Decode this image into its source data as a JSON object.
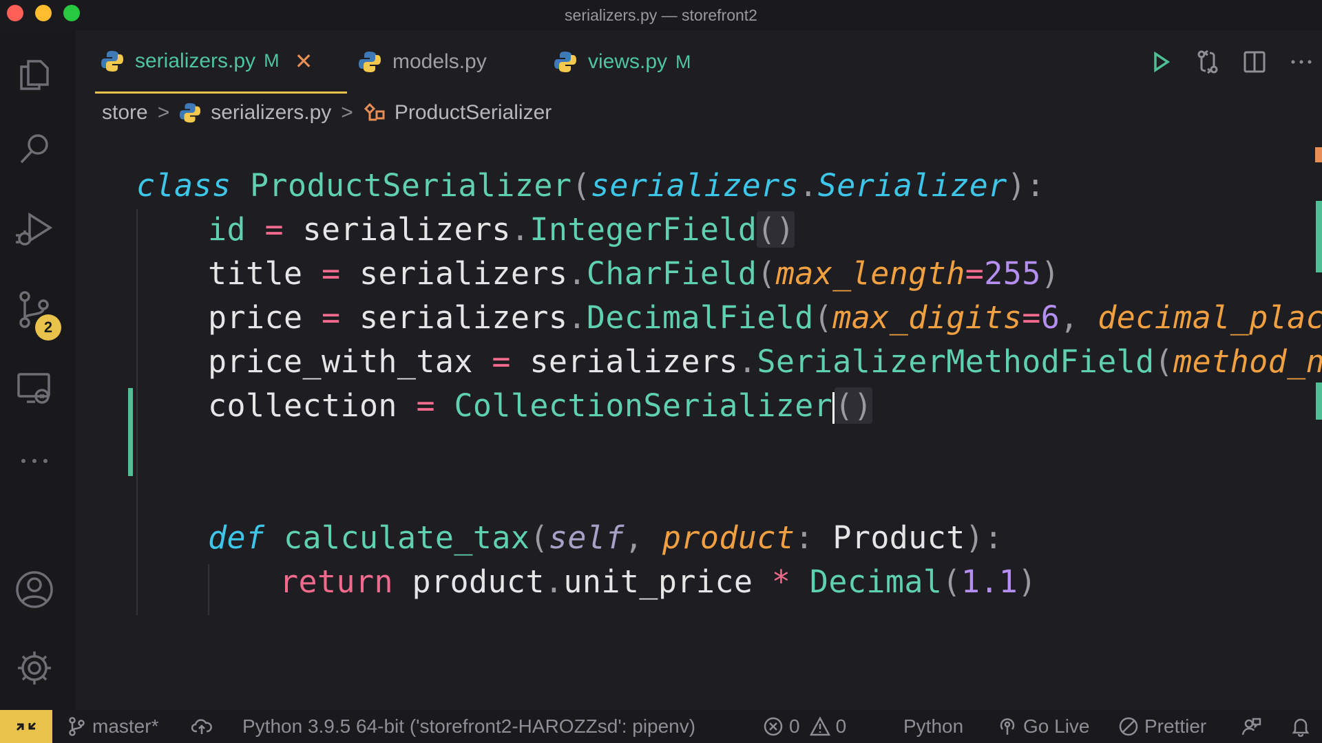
{
  "window": {
    "title": "serializers.py — storefront2"
  },
  "tabs": [
    {
      "label": "serializers.py",
      "marker": "M",
      "close": "✕"
    },
    {
      "label": "models.py",
      "marker": ""
    },
    {
      "label": "views.py",
      "marker": "M"
    }
  ],
  "breadcrumb": {
    "folder": "store",
    "file": "serializers.py",
    "symbol": "ProductSerializer",
    "sep": ">"
  },
  "activity": {
    "scm_badge": "2"
  },
  "code": {
    "l1": {
      "kw": "class",
      "name": "ProductSerializer",
      "p1": "(",
      "mod": "serializers",
      "dot": ".",
      "base": "Serializer",
      "p2": "):"
    },
    "l2": {
      "var": "id",
      "eq": "=",
      "mod": "serializers",
      "dot": ".",
      "fn": "IntegerField",
      "args": "()"
    },
    "l3": {
      "var": "title",
      "eq": "=",
      "mod": "serializers",
      "dot": ".",
      "fn": "CharField",
      "p1": "(",
      "kwarg": "max_length",
      "eq2": "=",
      "num": "255",
      "p2": ")"
    },
    "l4": {
      "var": "price",
      "eq": "=",
      "mod": "serializers",
      "dot": ".",
      "fn": "DecimalField",
      "p1": "(",
      "kwarg": "max_digits",
      "eq2": "=",
      "num": "6",
      "comma": ",",
      "kwarg2": "decimal_places",
      "eq3": "="
    },
    "l5": {
      "var": "price_with_tax",
      "eq": "=",
      "mod": "serializers",
      "dot": ".",
      "fn": "SerializerMethodField",
      "p1": "(",
      "kwarg": "method_name",
      "eq2": "="
    },
    "l6": {
      "var": "collection",
      "eq": "=",
      "fn": "CollectionSerializer",
      "args": "()"
    },
    "l7": {
      "kw": "def",
      "fn": "calculate_tax",
      "p1": "(",
      "self": "self",
      "comma": ",",
      "param": "product",
      "colon": ":",
      "type": "Product",
      "p2": "):"
    },
    "l8": {
      "kw": "return",
      "obj": "product",
      "dot": ".",
      "attr": "unit_price",
      "op": "*",
      "fn": "Decimal",
      "p1": "(",
      "num": "1.1",
      "p2": ")"
    }
  },
  "status": {
    "branch": "master*",
    "interpreter": "Python 3.9.5 64-bit ('storefront2-HAROZZsd': pipenv)",
    "errors": "0",
    "warnings": "0",
    "language": "Python",
    "golive": "Go Live",
    "prettier": "Prettier"
  },
  "colors": {
    "accent": "#e8c24a",
    "git_added": "#4fbf95"
  }
}
